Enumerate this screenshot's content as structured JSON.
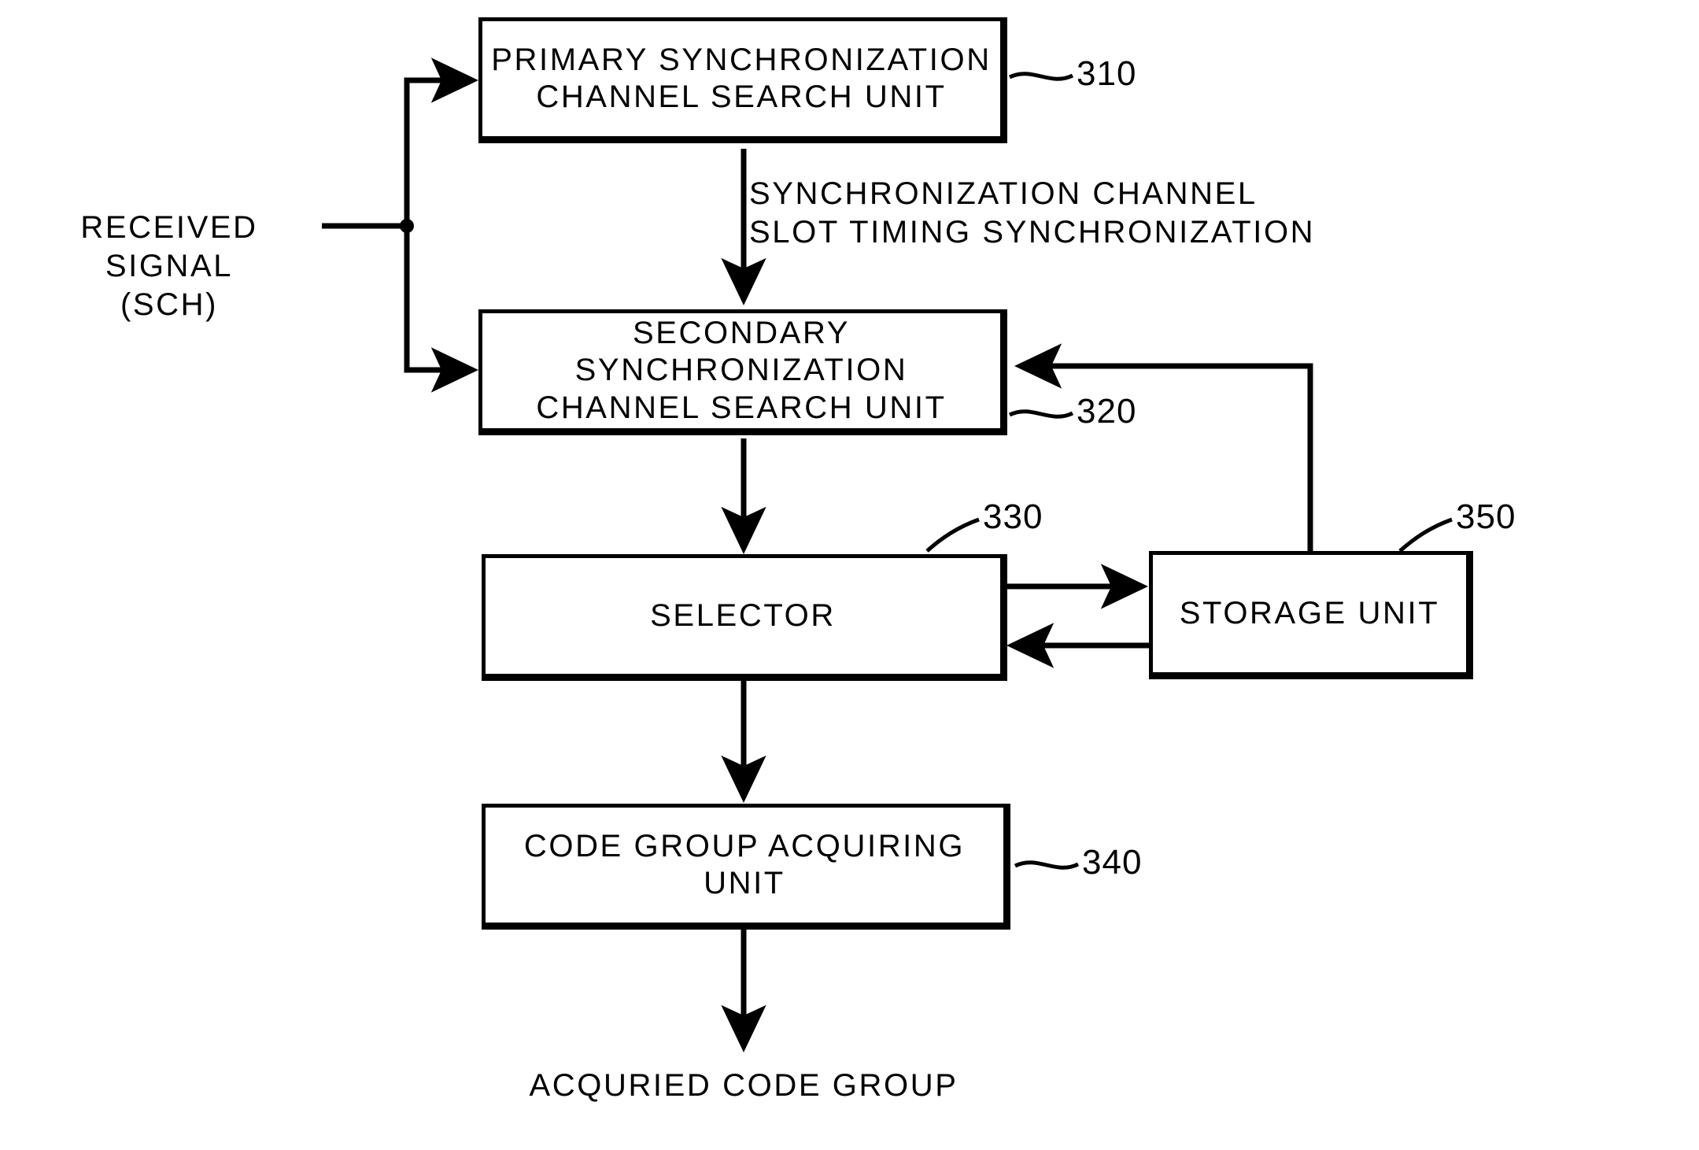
{
  "figure": {
    "type": "patent-block-diagram",
    "background": "#ffffff",
    "ink": "#000000"
  },
  "blocks": [
    {
      "id": "primary-sync-search",
      "label": "PRIMARY SYNCHRONIZATION\nCHANNEL SEARCH UNIT",
      "ref": "310"
    },
    {
      "id": "secondary-sync-search",
      "label": "SECONDARY SYNCHRONIZATION\nCHANNEL SEARCH UNIT",
      "ref": "320"
    },
    {
      "id": "selector",
      "label": "SELECTOR",
      "ref": "330"
    },
    {
      "id": "storage-unit",
      "label": "STORAGE UNIT",
      "ref": "350"
    },
    {
      "id": "code-group-acquiring",
      "label": "CODE GROUP ACQUIRING UNIT",
      "ref": "340"
    }
  ],
  "annotations": {
    "input_signal": "RECEIVED SIGNAL\n(SCH)",
    "sync_channel_timing": "SYNCHRONIZATION CHANNEL\nSLOT TIMING SYNCHRONIZATION",
    "output_signal": "ACQURIED CODE GROUP"
  }
}
